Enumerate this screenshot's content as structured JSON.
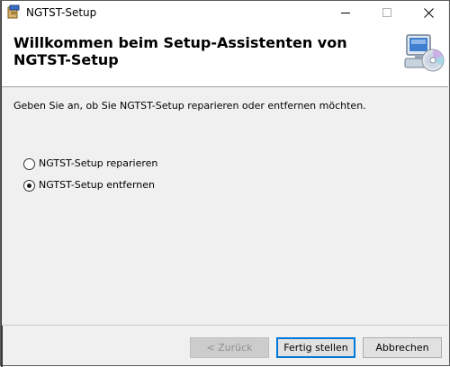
{
  "window": {
    "title": "NGTST-Setup",
    "icon": "installer-icon"
  },
  "controls": {
    "minimize_icon": "minimize-icon",
    "maximize_icon": "maximize-icon",
    "close_icon": "close-icon"
  },
  "header": {
    "title_line1": "Willkommen beim Setup-Assistenten von",
    "title_line2": "NGTST-Setup",
    "icon": "computer-cd-icon"
  },
  "content": {
    "instruction": "Geben Sie an, ob Sie NGTST-Setup reparieren oder entfernen möchten.",
    "options": [
      {
        "label": "NGTST-Setup reparieren",
        "checked": false
      },
      {
        "label": "NGTST-Setup entfernen",
        "checked": true
      }
    ]
  },
  "footer": {
    "back_label": "< Zurück",
    "finish_label": "Fertig stellen",
    "cancel_label": "Abbrechen"
  },
  "colors": {
    "accent": "#0078d7",
    "dialog_bg": "#f0f0f0",
    "header_bg": "#ffffff"
  }
}
